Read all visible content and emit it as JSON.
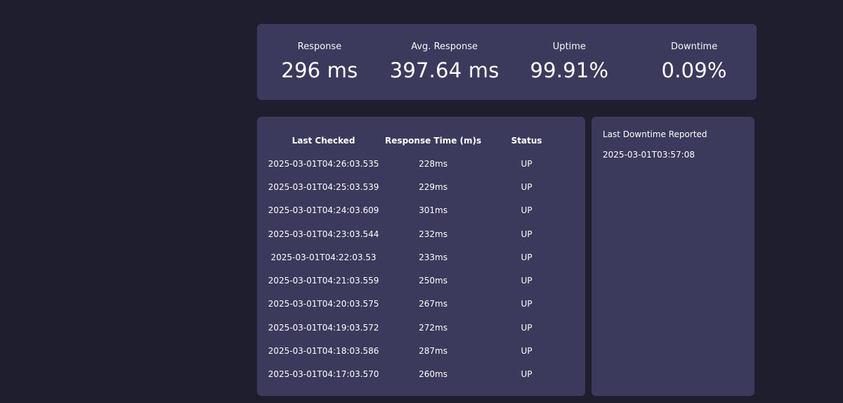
{
  "summary": {
    "metrics": [
      {
        "label": "Response",
        "value": "296 ms"
      },
      {
        "label": "Avg. Response",
        "value": "397.64 ms"
      },
      {
        "label": "Uptime",
        "value": "99.91%"
      },
      {
        "label": "Downtime",
        "value": "0.09%"
      }
    ]
  },
  "checks_table": {
    "headers": {
      "last_checked": "Last Checked",
      "response_time": "Response Time (m)s",
      "status": "Status"
    },
    "rows": [
      {
        "last_checked": "2025-03-01T04:26:03.535",
        "response_time": "228ms",
        "status": "UP"
      },
      {
        "last_checked": "2025-03-01T04:25:03.539",
        "response_time": "229ms",
        "status": "UP"
      },
      {
        "last_checked": "2025-03-01T04:24:03.609",
        "response_time": "301ms",
        "status": "UP"
      },
      {
        "last_checked": "2025-03-01T04:23:03.544",
        "response_time": "232ms",
        "status": "UP"
      },
      {
        "last_checked": "2025-03-01T04:22:03.53",
        "response_time": "233ms",
        "status": "UP"
      },
      {
        "last_checked": "2025-03-01T04:21:03.559",
        "response_time": "250ms",
        "status": "UP"
      },
      {
        "last_checked": "2025-03-01T04:20:03.575",
        "response_time": "267ms",
        "status": "UP"
      },
      {
        "last_checked": "2025-03-01T04:19:03.572",
        "response_time": "272ms",
        "status": "UP"
      },
      {
        "last_checked": "2025-03-01T04:18:03.586",
        "response_time": "287ms",
        "status": "UP"
      },
      {
        "last_checked": "2025-03-01T04:17:03.570",
        "response_time": "260ms",
        "status": "UP"
      }
    ]
  },
  "downtime": {
    "title": "Last Downtime Reported",
    "value": "2025-03-01T03:57:08"
  },
  "colors": {
    "page_background": "#1e1e2e",
    "panel_background": "#3b3a5c",
    "text": "#ffffff"
  }
}
